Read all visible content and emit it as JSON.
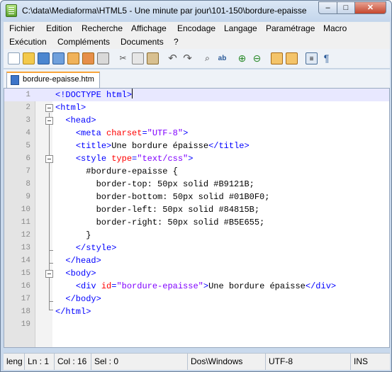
{
  "window": {
    "title": "C:\\data\\Mediaforma\\HTML5 - Une minute par jour\\101-150\\bordure-epaisse",
    "buttons": {
      "minimize": "–",
      "maximize": "□",
      "close": "✕"
    }
  },
  "menu": {
    "row1": [
      "Fichier",
      "Edition",
      "Recherche",
      "Affichage",
      "Encodage",
      "Langage",
      "Paramétrage",
      "Macro"
    ],
    "row2": [
      "Exécution",
      "Compléments",
      "Documents",
      "?"
    ]
  },
  "toolbar": {
    "icons": [
      "new-file-icon",
      "open-file-icon",
      "save-icon",
      "save-all-icon",
      "close-file-icon",
      "close-all-icon",
      "print-icon",
      "cut-icon",
      "copy-icon",
      "paste-icon",
      "undo-icon",
      "redo-icon",
      "find-icon",
      "replace-icon",
      "zoom-in-icon",
      "zoom-out-icon",
      "sync-vertical-icon",
      "sync-horizontal-icon",
      "word-wrap-icon",
      "show-all-chars-icon"
    ]
  },
  "tab": {
    "label": "bordure-epaisse.htm"
  },
  "editor": {
    "lines": [
      {
        "n": "1",
        "text": "<!DOCTYPE html>",
        "current": true
      },
      {
        "n": "2",
        "text": "<html>"
      },
      {
        "n": "3",
        "text": "  <head>"
      },
      {
        "n": "4",
        "text": "    <meta charset=\"UTF-8\">"
      },
      {
        "n": "5",
        "text": "    <title>Une bordure épaisse</title>"
      },
      {
        "n": "6",
        "text": "    <style type=\"text/css\">"
      },
      {
        "n": "7",
        "text": "      #bordure-epaisse {"
      },
      {
        "n": "8",
        "text": "        border-top: 50px solid #B9121B;"
      },
      {
        "n": "9",
        "text": "        border-bottom: 50px solid #01B0F0;"
      },
      {
        "n": "10",
        "text": "        border-left: 50px solid #84815B;"
      },
      {
        "n": "11",
        "text": "        border-right: 50px solid #B5E655;"
      },
      {
        "n": "12",
        "text": "      }"
      },
      {
        "n": "13",
        "text": "    </style>"
      },
      {
        "n": "14",
        "text": "  </head>"
      },
      {
        "n": "15",
        "text": "  <body>"
      },
      {
        "n": "16",
        "text": "    <div id=\"bordure-epaisse\">Une bordure épaisse</div>"
      },
      {
        "n": "17",
        "text": "  </body>"
      },
      {
        "n": "18",
        "text": "</html>"
      },
      {
        "n": "19",
        "text": ""
      }
    ]
  },
  "status": {
    "length": "leng",
    "line": "Ln : 1",
    "col": "Col : 16",
    "sel": "Sel : 0",
    "eol": "Dos\\Windows",
    "encoding": "UTF-8",
    "mode": "INS"
  },
  "colors": {
    "tag": "#0000ff",
    "attribute": "#ff0000",
    "value": "#8000ff",
    "current_line": "#e8e8ff",
    "tab_accent": "#f8a43a"
  }
}
